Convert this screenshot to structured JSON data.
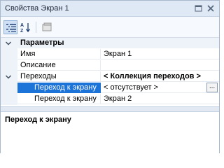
{
  "window": {
    "title": "Свойства Экран 1",
    "icons": [
      "dock-icon",
      "close-icon"
    ]
  },
  "toolbar": {
    "buttons": [
      {
        "name": "categorized-icon",
        "active": true
      },
      {
        "name": "sort-alphabetical-icon",
        "active": false
      },
      {
        "name": "property-pages-icon",
        "active": false
      }
    ]
  },
  "grid": {
    "rows": [
      {
        "type": "category",
        "label": "Параметры",
        "expanded": true
      },
      {
        "type": "property",
        "label": "Имя",
        "value": "Экран 1"
      },
      {
        "type": "property",
        "label": "Описание",
        "value": ""
      },
      {
        "type": "property",
        "label": "Переходы",
        "value": "< Коллекция переходов >",
        "expanded": true
      },
      {
        "type": "subproperty",
        "label": "Переход к экрану",
        "value": "< отсутствует >",
        "selected": true,
        "button": "..."
      },
      {
        "type": "subproperty",
        "label": "Переход к экрану",
        "value": "Экран 2"
      }
    ]
  },
  "description": {
    "title": "Переход к экрану"
  },
  "colors": {
    "selection": "#1c73d8",
    "panel_bg": "#eef3fa",
    "title_bg": "#dfe8f5"
  }
}
